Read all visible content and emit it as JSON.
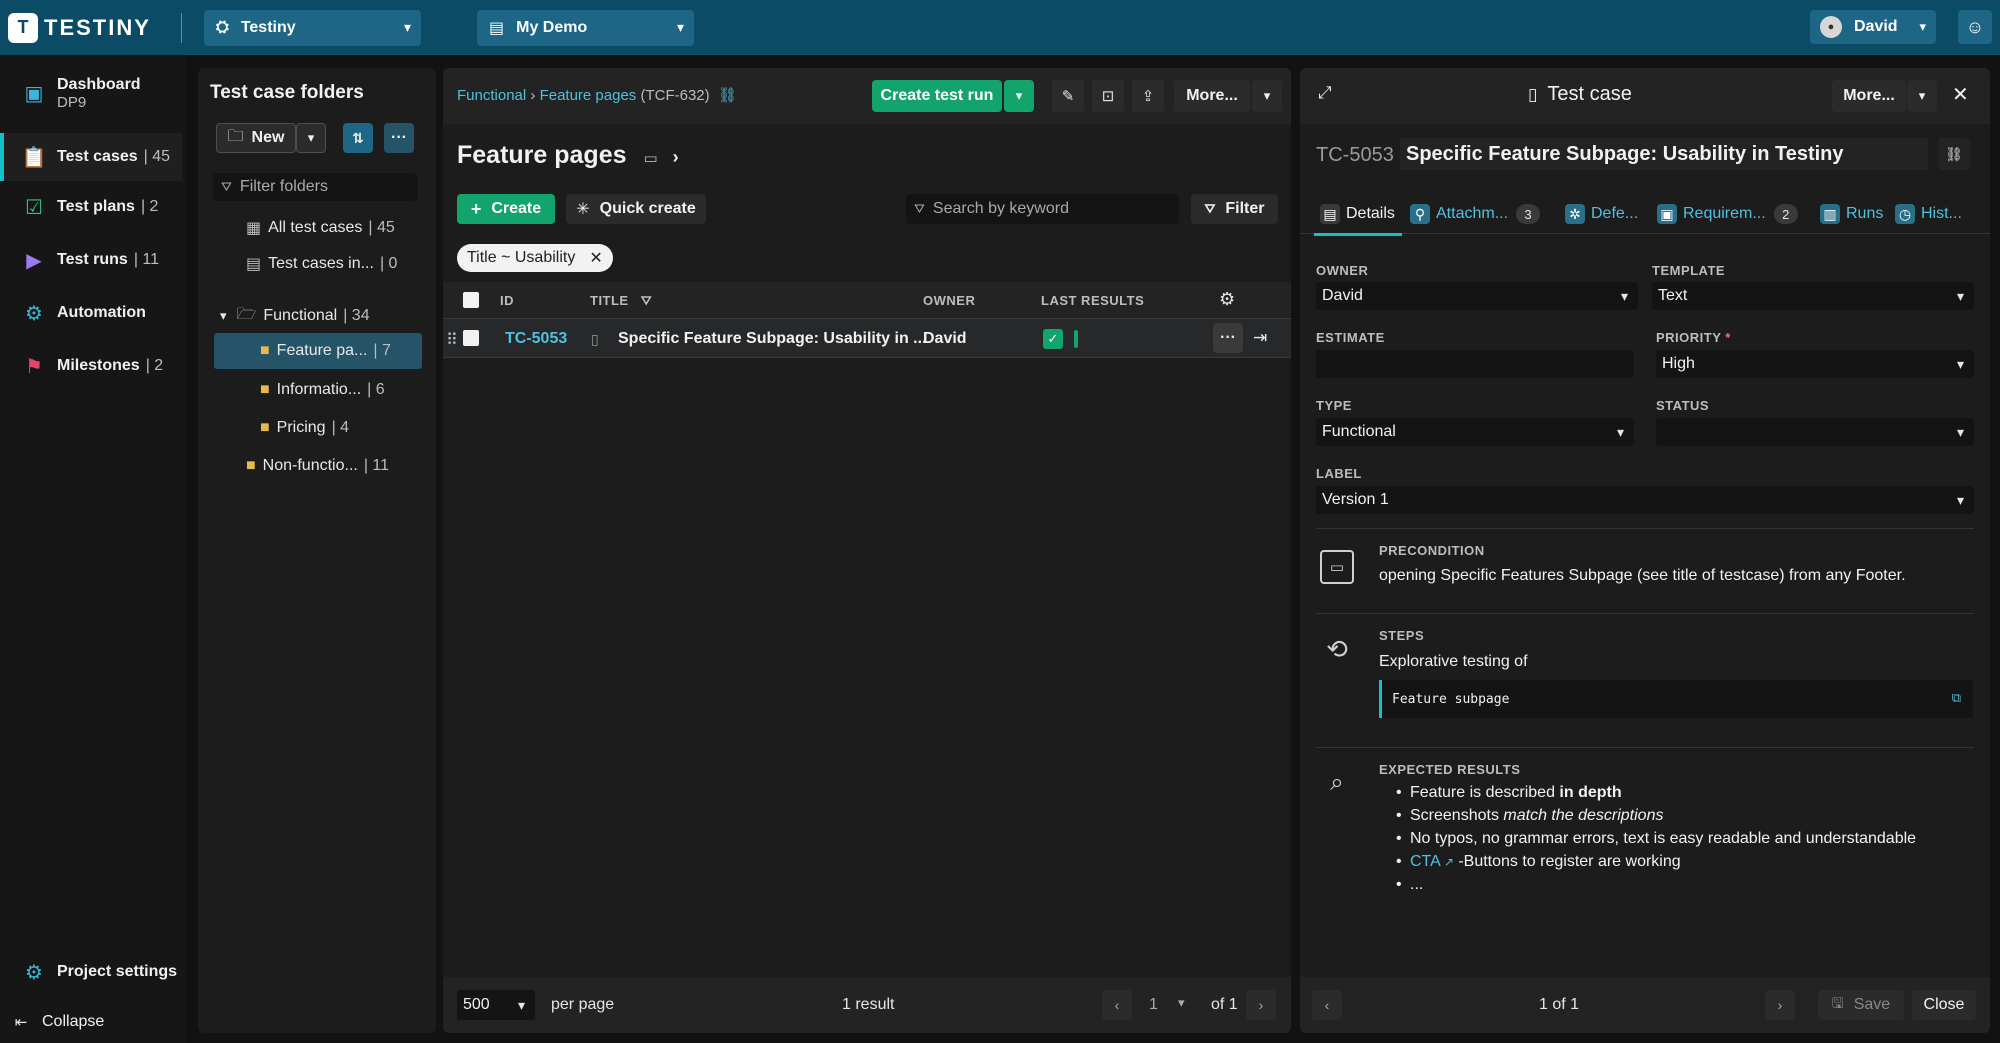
{
  "app": {
    "logo_text": "TESTINY"
  },
  "topbar": {
    "project_select": "Testiny",
    "demo_select": "My Demo",
    "user_name": "David"
  },
  "leftnav": {
    "items": [
      {
        "label": "Dashboard",
        "sub": "DP9",
        "icon": "dashboard-icon"
      },
      {
        "label": "Test cases",
        "count": "| 45",
        "icon": "clipboard-icon"
      },
      {
        "label": "Test plans",
        "count": "| 2",
        "icon": "clipboard-check-icon"
      },
      {
        "label": "Test runs",
        "count": "| 11",
        "icon": "play-clipboard-icon"
      },
      {
        "label": "Automation",
        "icon": "gear-cycle-icon"
      },
      {
        "label": "Milestones",
        "count": "| 2",
        "icon": "flag-icon"
      }
    ],
    "project_settings": "Project settings",
    "collapse": "Collapse"
  },
  "folders": {
    "title": "Test case folders",
    "new_label": "New",
    "filter_placeholder": "Filter folders",
    "items": [
      {
        "label": "All test cases",
        "count": "| 45"
      },
      {
        "label": "Test cases in...",
        "count": "| 0"
      },
      {
        "label": "Functional",
        "count": "| 34"
      },
      {
        "label": "Feature pa...",
        "count": "| 7"
      },
      {
        "label": "Informatio...",
        "count": "| 6"
      },
      {
        "label": "Pricing",
        "count": "| 4"
      },
      {
        "label": "Non-functio...",
        "count": "| 11"
      }
    ]
  },
  "middle": {
    "breadcrumb": {
      "part1": "Functional",
      "sep": "›",
      "part2": "Feature pages",
      "part3": "(TCF-632)"
    },
    "create_test_run": "Create test run",
    "more": "More...",
    "title": "Feature pages",
    "create": "Create",
    "quick_create": "Quick create",
    "search_placeholder": "Search by keyword",
    "filter": "Filter",
    "chip": "Title ~ Usability",
    "columns": {
      "id": "ID",
      "title": "TITLE",
      "owner": "OWNER",
      "last_results": "LAST RESULTS"
    },
    "rows": [
      {
        "id": "TC-5053",
        "title": "Specific Feature Subpage: Usability in ...",
        "owner": "David"
      }
    ],
    "footer": {
      "per_page_value": "500",
      "per_page": "per page",
      "result": "1 result",
      "page": "1",
      "of": "of 1"
    }
  },
  "right": {
    "title": "Test case",
    "more": "More...",
    "tc_id": "TC-5053",
    "tc_title": "Specific Feature Subpage: Usability in Testiny",
    "tabs": [
      {
        "label": "Details"
      },
      {
        "label": "Attachm...",
        "badge": "3"
      },
      {
        "label": "Defe..."
      },
      {
        "label": "Requirem...",
        "badge": "2"
      },
      {
        "label": "Runs"
      },
      {
        "label": "Hist..."
      }
    ],
    "fields": {
      "owner_label": "OWNER",
      "owner": "David",
      "template_label": "TEMPLATE",
      "template": "Text",
      "estimate_label": "ESTIMATE",
      "estimate": "",
      "priority_label": "PRIORITY",
      "priority_required": "*",
      "priority": "High",
      "type_label": "TYPE",
      "type": "Functional",
      "status_label": "STATUS",
      "status": "",
      "label_label": "LABEL",
      "label": "Version 1"
    },
    "precondition": {
      "label": "PRECONDITION",
      "text": "opening Specific Features Subpage (see title of testcase) from any Footer."
    },
    "steps": {
      "label": "STEPS",
      "text": "Explorative testing of",
      "code": "Feature subpage"
    },
    "expected": {
      "label": "EXPECTED RESULTS",
      "b1_a": "Feature is described ",
      "b1_b": "in depth",
      "b2_a": "Screenshots ",
      "b2_b": "match the descriptions",
      "b3": "No typos, no grammar errors, text is easy readable and understandable",
      "b4_a": "CTA",
      "b4_b": " -Buttons to register are working",
      "b5": "..."
    },
    "footer": {
      "pager": "1 of 1",
      "save": "Save",
      "close": "Close"
    }
  },
  "colors": {
    "topbar": "#0b4b66",
    "accent": "#16c0c9",
    "green": "#13a36d",
    "link": "#4fc1e0"
  }
}
